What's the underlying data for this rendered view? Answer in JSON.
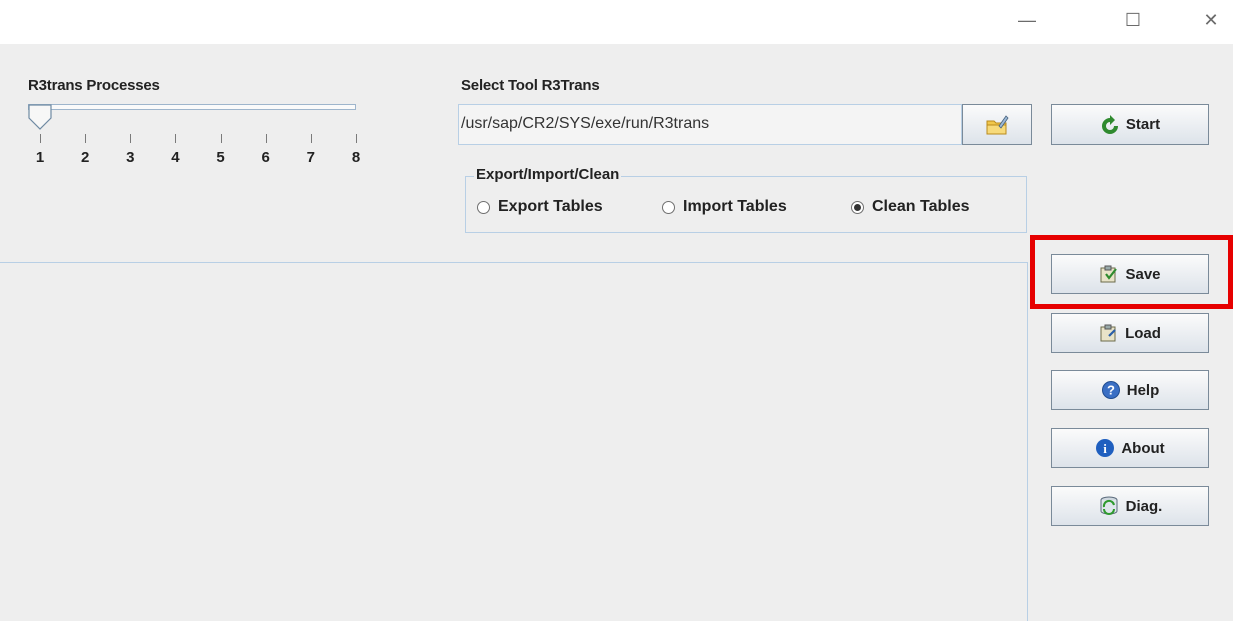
{
  "window": {
    "minimize": "—",
    "maximize": "☐",
    "close": "✕"
  },
  "processes": {
    "label": "R3trans Processes",
    "value": 1,
    "min": 1,
    "max": 8,
    "ticks": [
      "1",
      "2",
      "3",
      "4",
      "5",
      "6",
      "7",
      "8"
    ]
  },
  "tool": {
    "label": "Select Tool R3Trans",
    "path": "/usr/sap/CR2/SYS/exe/run/R3trans"
  },
  "mode": {
    "title": "Export/Import/Clean",
    "options": [
      {
        "label": "Export Tables",
        "selected": false
      },
      {
        "label": "Import Tables",
        "selected": false
      },
      {
        "label": "Clean Tables",
        "selected": true
      }
    ]
  },
  "buttons": {
    "start": "Start",
    "save": "Save",
    "load": "Load",
    "help": "Help",
    "about": "About",
    "diag": "Diag."
  },
  "colors": {
    "highlight": "#e60000",
    "panel": "#eeeeee",
    "border": "#b8cfe5"
  }
}
